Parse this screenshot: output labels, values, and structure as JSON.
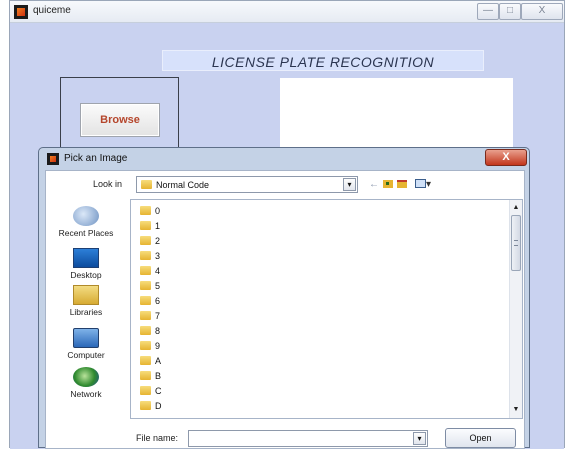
{
  "main_window": {
    "title": "quiceme",
    "controls": {
      "minimize": "—",
      "maximize": "□",
      "close": "X"
    },
    "heading": "LICENSE PLATE RECOGNITION",
    "browse_label": "Browse"
  },
  "dialog": {
    "title": "Pick an Image",
    "close": "X",
    "look_in_label": "Look in",
    "look_in_value": "Normal Code",
    "toolbar": {
      "back": "←",
      "views_arrow": "▾"
    },
    "places": [
      {
        "label": "Recent Places",
        "icon": "recent-places-icon"
      },
      {
        "label": "Desktop",
        "icon": "desktop-icon"
      },
      {
        "label": "Libraries",
        "icon": "libraries-icon"
      },
      {
        "label": "Computer",
        "icon": "computer-icon"
      },
      {
        "label": "Network",
        "icon": "network-icon"
      }
    ],
    "files": [
      "0",
      "1",
      "2",
      "3",
      "4",
      "5",
      "6",
      "7",
      "8",
      "9",
      "A",
      "B",
      "C",
      "D"
    ],
    "scroll": {
      "up": "▲",
      "down": "▼"
    },
    "file_name_label": "File name:",
    "file_name_value": "",
    "open_label": "Open"
  }
}
